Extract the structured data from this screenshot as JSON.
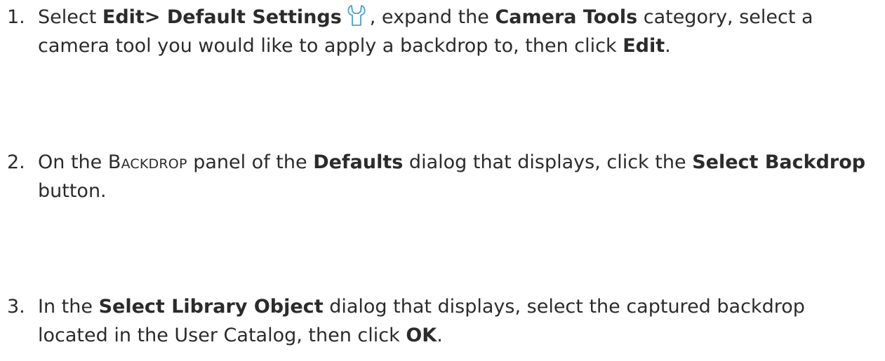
{
  "steps": [
    {
      "number": "1.",
      "t1": "Select ",
      "b1": "Edit> Default Settings",
      "icon": "wrench-settings-icon",
      "t2": ", expand the ",
      "b2": "Camera Tools",
      "t3": " category, select a camera tool you would like to apply a backdrop to, then click ",
      "b3": "Edit",
      "t4": "."
    },
    {
      "number": "2.",
      "t1": "On the ",
      "sc1": "Backdrop",
      "t2": " panel of the ",
      "b1": "Defaults",
      "t3": " dialog that displays, click the ",
      "b2": "Select Backdrop",
      "t4": " button."
    },
    {
      "number": "3.",
      "t1": "In the ",
      "b1": "Select Library Object",
      "t2": " dialog that displays, select the captured backdrop located in the User Catalog, then click ",
      "b2": "OK",
      "t3": "."
    }
  ],
  "colors": {
    "text": "#2b2b2b",
    "icon_stroke": "#4a9fd8"
  }
}
